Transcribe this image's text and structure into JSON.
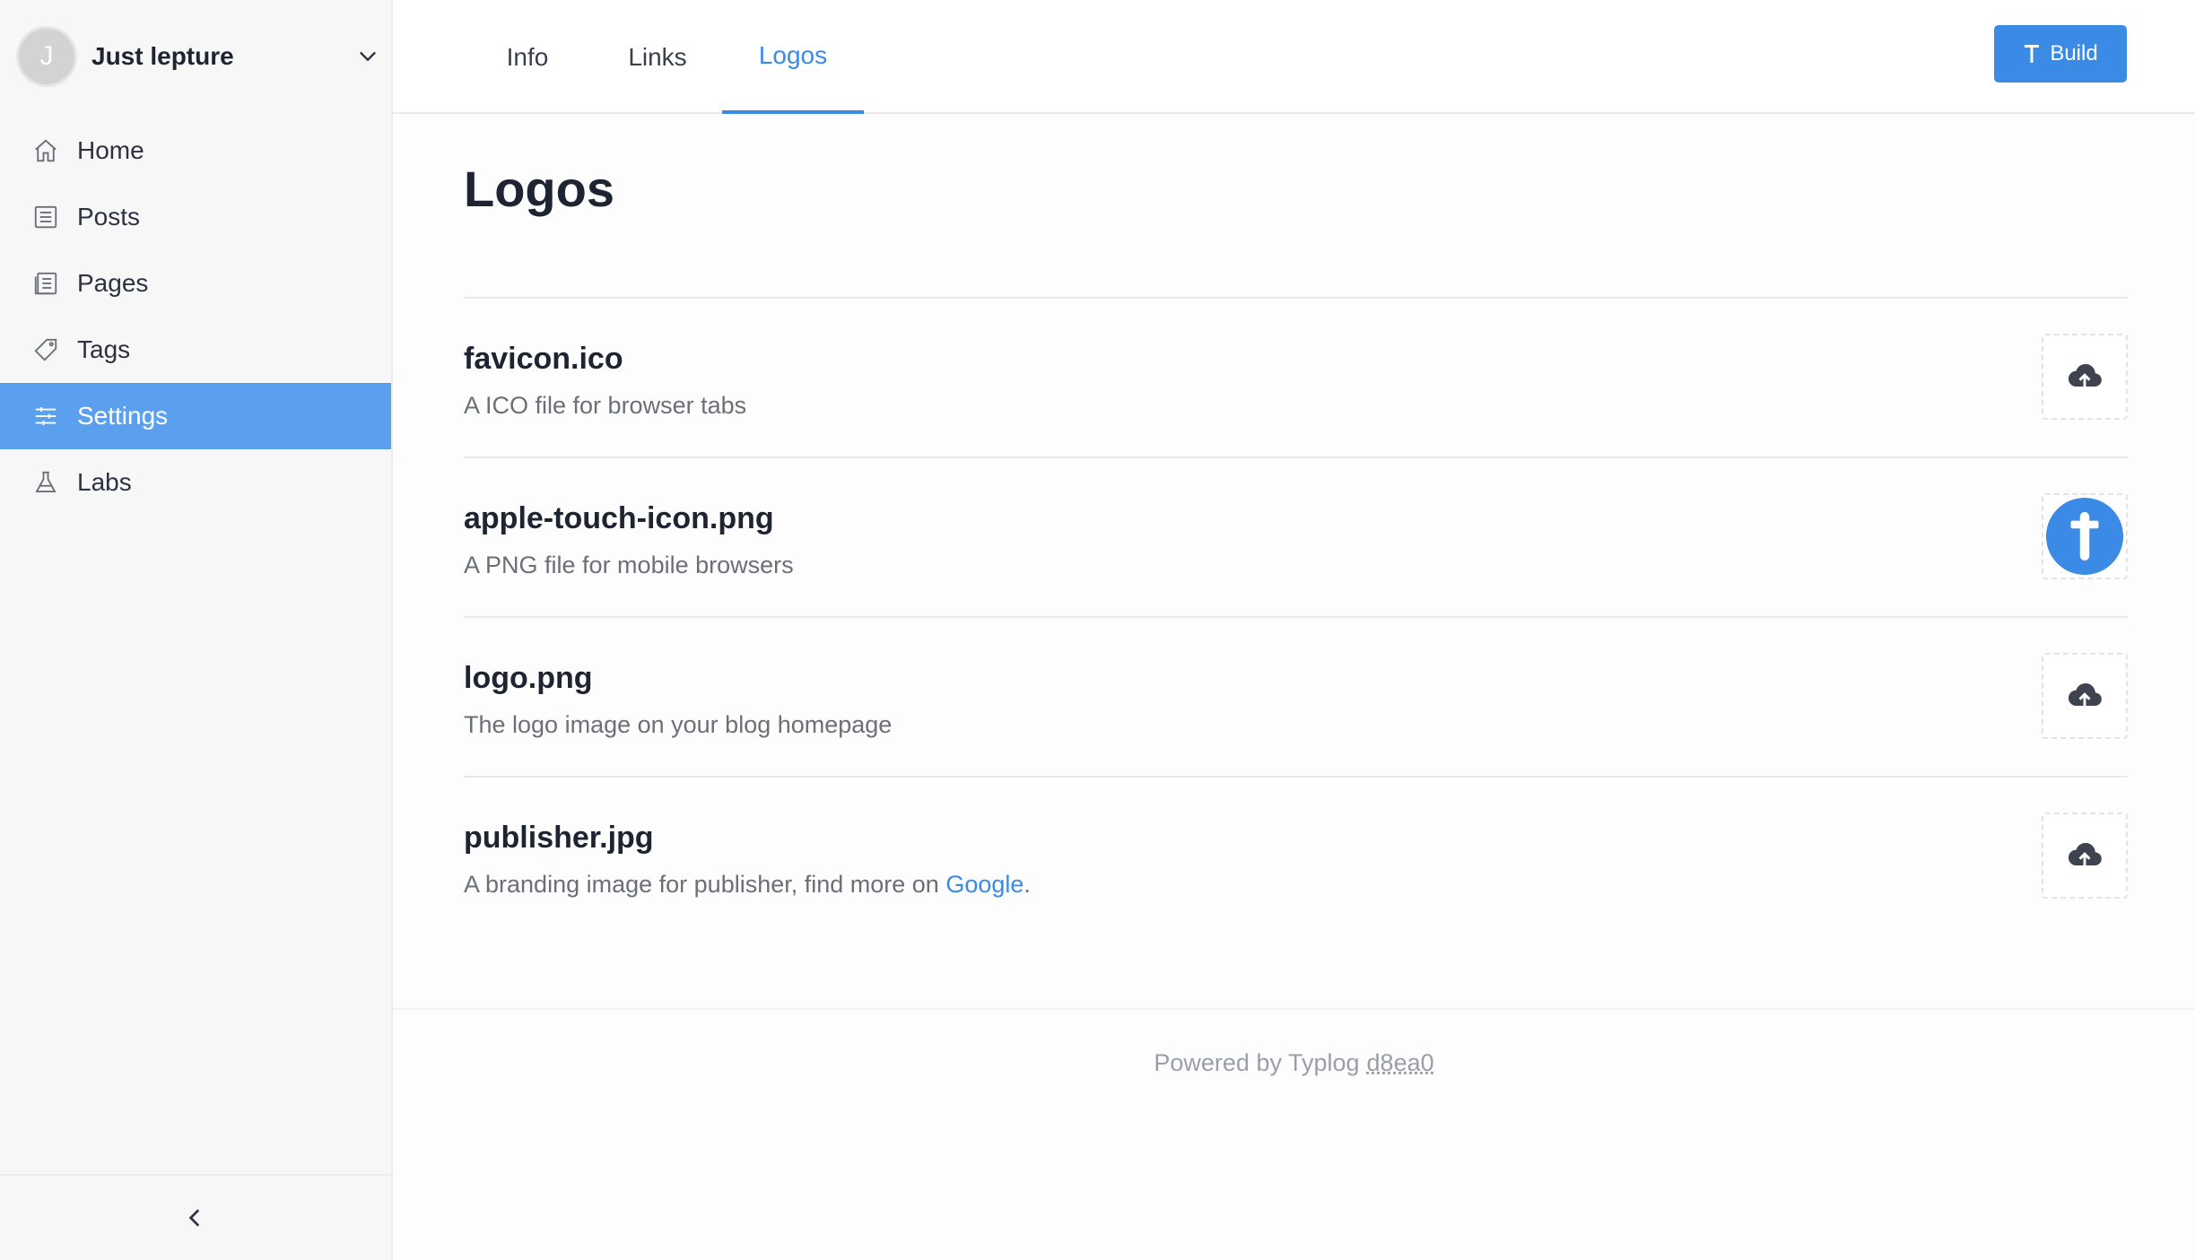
{
  "sidebar": {
    "avatar_initial": "J",
    "site_name": "Just lepture",
    "items": [
      {
        "label": "Home",
        "icon": "home-icon",
        "active": false
      },
      {
        "label": "Posts",
        "icon": "posts-icon",
        "active": false
      },
      {
        "label": "Pages",
        "icon": "pages-icon",
        "active": false
      },
      {
        "label": "Tags",
        "icon": "tag-icon",
        "active": false
      },
      {
        "label": "Settings",
        "icon": "sliders-icon",
        "active": true
      },
      {
        "label": "Labs",
        "icon": "flask-icon",
        "active": false
      }
    ],
    "collapse_icon": "chevron-left-icon"
  },
  "header": {
    "tabs": [
      {
        "label": "Info",
        "active": false
      },
      {
        "label": "Links",
        "active": false
      },
      {
        "label": "Logos",
        "active": true
      }
    ],
    "build_label": "Build"
  },
  "main": {
    "title": "Logos",
    "logos": [
      {
        "name": "favicon.ico",
        "description": "A ICO file for browser tabs",
        "state": "upload",
        "icon": "cloud-upload-icon"
      },
      {
        "name": "apple-touch-icon.png",
        "description": "A PNG file for mobile browsers",
        "state": "uploaded",
        "icon": "typlog-logo-icon"
      },
      {
        "name": "logo.png",
        "description": "The logo image on your blog homepage",
        "state": "upload",
        "icon": "cloud-upload-icon"
      },
      {
        "name": "publisher.jpg",
        "description": "A branding image for publisher, find more on ",
        "link_text": "Google",
        "suffix": ".",
        "state": "upload",
        "icon": "cloud-upload-icon"
      }
    ]
  },
  "footer": {
    "text": "Powered by Typlog",
    "commit": "d8ea0"
  },
  "colors": {
    "accent": "#3a8ae6",
    "sidebar_active": "#5aa0ef"
  }
}
